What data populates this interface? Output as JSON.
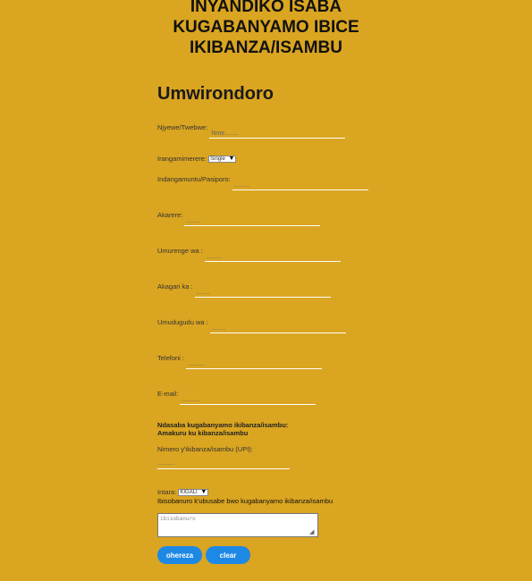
{
  "header": {
    "title_line1": "INYANDIKO ISABA",
    "title_line2": "KUGABANYAMO IBICE",
    "title_line3": "IKIBANZA/ISAMBU"
  },
  "section": {
    "heading": "Umwirondoro"
  },
  "fields": {
    "name": {
      "label": "Njyewe/Twebwe:",
      "placeholder": "Nme........"
    },
    "marital": {
      "label": "Irangamimerere:",
      "selected": "Single"
    },
    "id_number": {
      "label": "Indangamuntu/Pasiporo:",
      "placeholder": "........."
    },
    "district": {
      "label": "Akarere:",
      "placeholder": "........"
    },
    "sector": {
      "label": "Umurenge wa :",
      "placeholder": "........."
    },
    "cell": {
      "label": "Akagari ka :",
      "placeholder": "........"
    },
    "village": {
      "label": "Umudugudu wa :",
      "placeholder": "........"
    },
    "phone": {
      "label": "Telefoni :",
      "placeholder": ".........."
    },
    "email": {
      "label": "E-mail:",
      "placeholder": ".........."
    }
  },
  "parcel": {
    "request_line1": "Ndasaba kugabanyamo ikibanza/isambu:",
    "request_line2": "Amakuru ku kibanza/isambu",
    "upi_label": "Nimero y'ikibanza/isambu (UPI):",
    "upi_placeholder": "..........",
    "province_label": "Intara:",
    "province_selected": "KIGALI",
    "reasons_label": "Ibisobanuro k'ubusabe bwo kugabanyamo ikibanza/isambu",
    "reasons_placeholder": "ibisobanuro"
  },
  "buttons": {
    "submit": "ohereza",
    "clear": "clear"
  },
  "colors": {
    "background": "#DAA520",
    "button": "#1E88E5",
    "input_line": "#FFFFFF"
  }
}
